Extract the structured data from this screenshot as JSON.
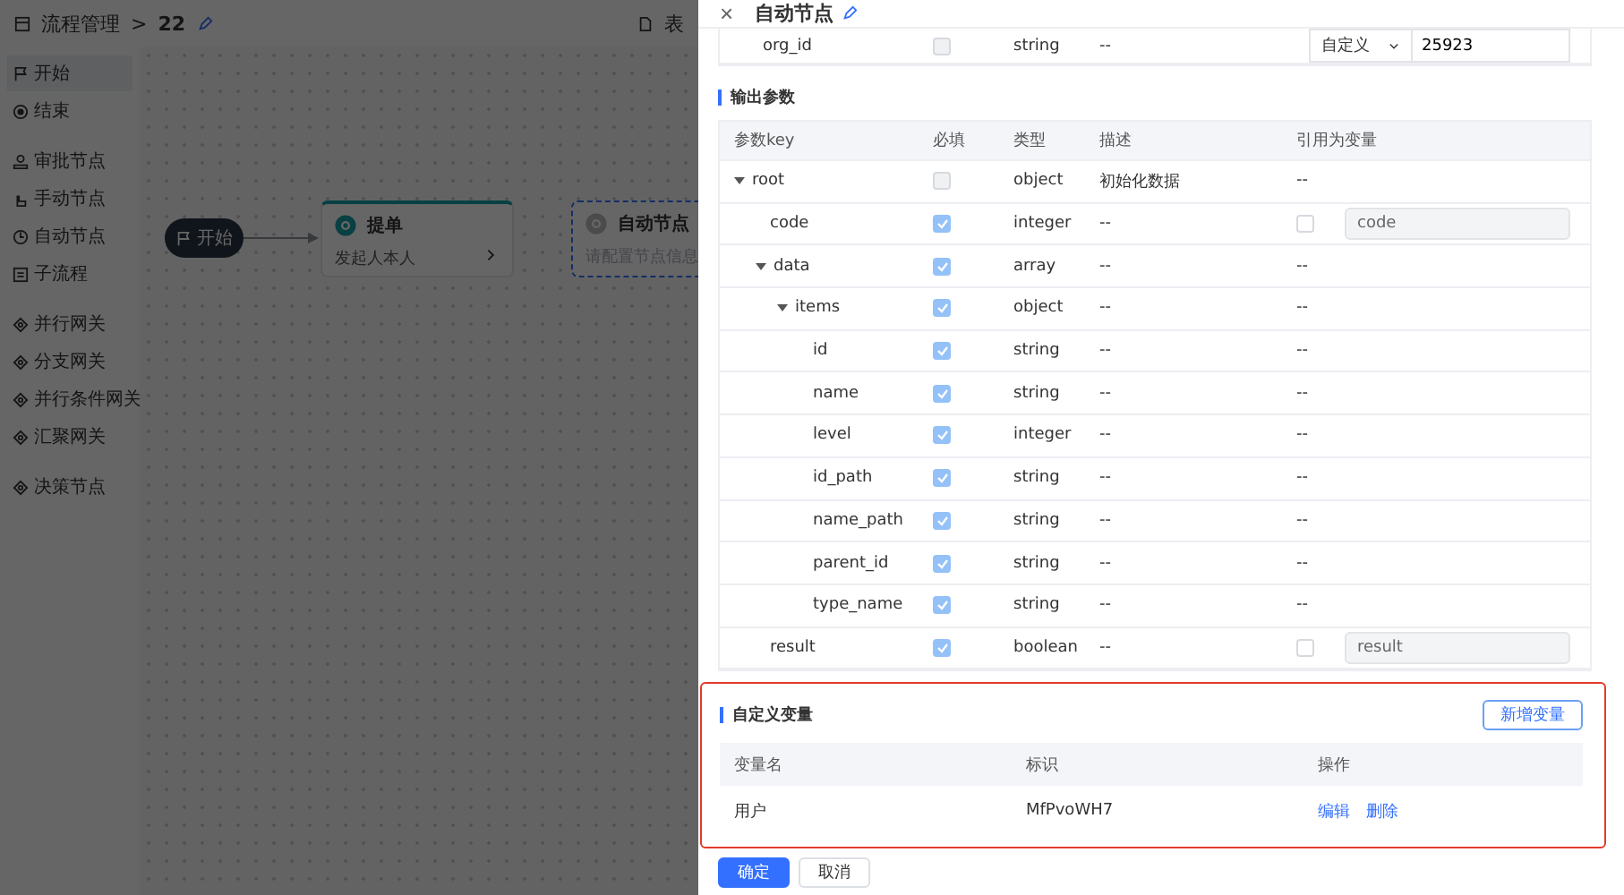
{
  "background": {
    "breadcrumb": {
      "root": "流程管理",
      "separator": ">",
      "current": "22"
    },
    "header_right": "表",
    "palette_groups": [
      {
        "items": [
          {
            "kind": "flag",
            "label": "开始"
          },
          {
            "kind": "stop",
            "label": "结束"
          }
        ]
      },
      {
        "items": [
          {
            "kind": "user",
            "label": "审批节点"
          },
          {
            "kind": "hand",
            "label": "手动节点"
          },
          {
            "kind": "clock",
            "label": "自动节点"
          },
          {
            "kind": "sub",
            "label": "子流程"
          }
        ]
      },
      {
        "items": [
          {
            "kind": "diamond",
            "label": "并行网关"
          },
          {
            "kind": "diamond",
            "label": "分支网关"
          },
          {
            "kind": "diamond",
            "label": "并行条件网关"
          },
          {
            "kind": "diamond",
            "label": "汇聚网关"
          }
        ]
      },
      {
        "items": [
          {
            "kind": "diamond",
            "label": "决策节点"
          }
        ]
      }
    ],
    "nodes": [
      {
        "kind": "start",
        "label": "开始"
      },
      {
        "kind": "task",
        "title": "提单",
        "subtitle": "发起人本人",
        "selected": false
      },
      {
        "kind": "task",
        "title": "自动节点",
        "subtitle": "请配置节点信息",
        "selected": true
      }
    ]
  },
  "drawer": {
    "close": "×",
    "title": "自动节点",
    "input_row": {
      "key": "org_id",
      "required": false,
      "type": "string",
      "desc": "--",
      "source": "自定义",
      "value": "25923"
    },
    "output_section": "输出参数",
    "output_columns": [
      "参数key",
      "必填",
      "类型",
      "描述",
      "引用为变量"
    ],
    "output_rows": [
      {
        "key": "root",
        "expanded": true,
        "required": false,
        "disabled": true,
        "type": "object",
        "desc": "初始化数据",
        "ref": {
          "kind": "dash",
          "text": "--"
        },
        "children": [
          {
            "key": "code",
            "required": true,
            "type": "integer",
            "desc": "--",
            "ref": {
              "kind": "variable",
              "checked": false,
              "value": "code"
            }
          },
          {
            "key": "data",
            "expanded": true,
            "required": true,
            "type": "array",
            "desc": "--",
            "ref": {
              "kind": "dash",
              "text": "--"
            },
            "children": [
              {
                "key": "items",
                "expanded": true,
                "required": true,
                "type": "object",
                "desc": "--",
                "ref": {
                  "kind": "dash",
                  "text": "--"
                },
                "children": [
                  {
                    "key": "id",
                    "required": true,
                    "type": "string",
                    "desc": "--",
                    "ref": {
                      "kind": "dash",
                      "text": "--"
                    }
                  },
                  {
                    "key": "name",
                    "required": true,
                    "type": "string",
                    "desc": "--",
                    "ref": {
                      "kind": "dash",
                      "text": "--"
                    }
                  },
                  {
                    "key": "level",
                    "required": true,
                    "type": "integer",
                    "desc": "--",
                    "ref": {
                      "kind": "dash",
                      "text": "--"
                    }
                  },
                  {
                    "key": "id_path",
                    "required": true,
                    "type": "string",
                    "desc": "--",
                    "ref": {
                      "kind": "dash",
                      "text": "--"
                    }
                  },
                  {
                    "key": "name_path",
                    "required": true,
                    "type": "string",
                    "desc": "--",
                    "ref": {
                      "kind": "dash",
                      "text": "--"
                    }
                  },
                  {
                    "key": "parent_id",
                    "required": true,
                    "type": "string",
                    "desc": "--",
                    "ref": {
                      "kind": "dash",
                      "text": "--"
                    }
                  },
                  {
                    "key": "type_name",
                    "required": true,
                    "type": "string",
                    "desc": "--",
                    "ref": {
                      "kind": "dash",
                      "text": "--"
                    }
                  }
                ]
              }
            ]
          },
          {
            "key": "result",
            "required": true,
            "type": "boolean",
            "desc": "--",
            "ref": {
              "kind": "variable",
              "checked": false,
              "value": "result"
            }
          }
        ]
      }
    ],
    "custom_section": "自定义变量",
    "add_button": "新增变量",
    "custom_columns": [
      "变量名",
      "标识",
      "操作"
    ],
    "custom_rows": [
      {
        "name": "用户",
        "id": "MfPvoWH7",
        "actions": [
          "编辑",
          "删除"
        ]
      }
    ],
    "footer": [
      "确定",
      "取消"
    ]
  }
}
